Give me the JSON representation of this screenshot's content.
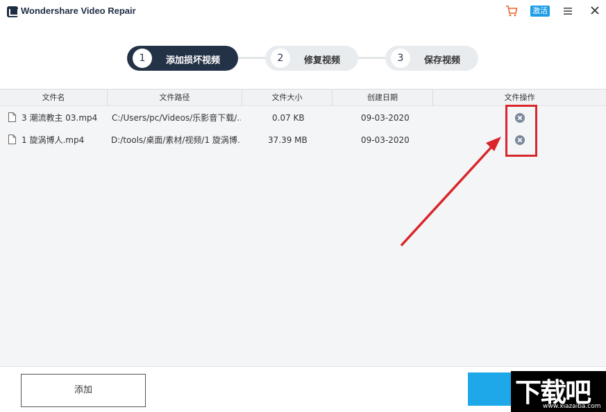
{
  "window": {
    "title": "Wondershare Video Repair",
    "activate_label": "激活"
  },
  "steps": [
    {
      "num": "1",
      "label": "添加损坏视频",
      "active": true
    },
    {
      "num": "2",
      "label": "修复视频",
      "active": false
    },
    {
      "num": "3",
      "label": "保存视频",
      "active": false
    }
  ],
  "table": {
    "headers": [
      "文件名",
      "文件路径",
      "文件大小",
      "创建日期",
      "文件操作"
    ],
    "rows": [
      {
        "name": "3 潮流教主 03.mp4",
        "path": "C:/Users/pc/Videos/乐影音下载/...",
        "size": "0.07  KB",
        "date": "09-03-2020"
      },
      {
        "name": "1 旋涡博人.mp4",
        "path": "D:/tools/桌面/素材/视频/1 旋涡博...",
        "size": "37.39  MB",
        "date": "09-03-2020"
      }
    ]
  },
  "footer": {
    "add_label": "添加"
  },
  "watermark": {
    "text": "下载吧",
    "url": "www.xiazaiba.com"
  },
  "colors": {
    "accent": "#1fa8e9",
    "step_active": "#243247",
    "annotation": "#d9262a"
  }
}
